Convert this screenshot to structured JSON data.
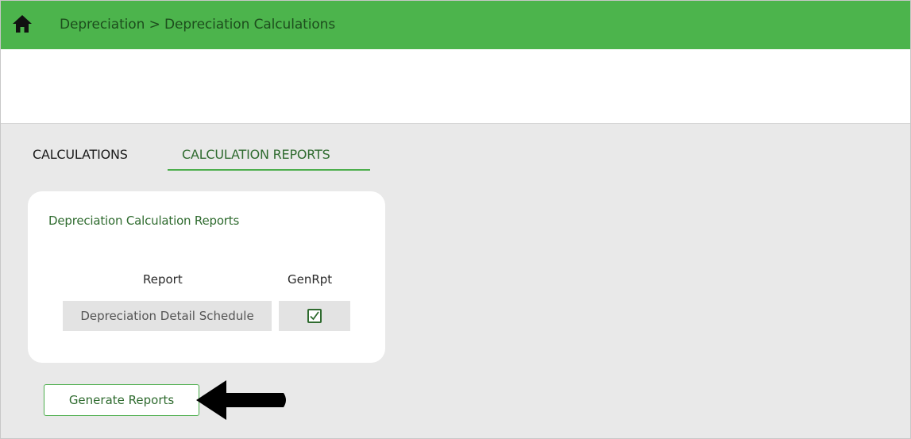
{
  "header": {
    "breadcrumb": "Depreciation > Depreciation Calculations",
    "home_icon": "home-icon",
    "color": "#4cb44c"
  },
  "tabs": [
    {
      "label": "CALCULATIONS",
      "active": false
    },
    {
      "label": "CALCULATION REPORTS",
      "active": true
    }
  ],
  "card": {
    "title": "Depreciation Calculation Reports",
    "columns": [
      "Report",
      "GenRpt"
    ],
    "rows": [
      {
        "report": "Depreciation Detail Schedule",
        "genrpt_checked": true
      }
    ]
  },
  "actions": {
    "generate_label": "Generate Reports"
  },
  "accent_color": "#2f6b2f"
}
